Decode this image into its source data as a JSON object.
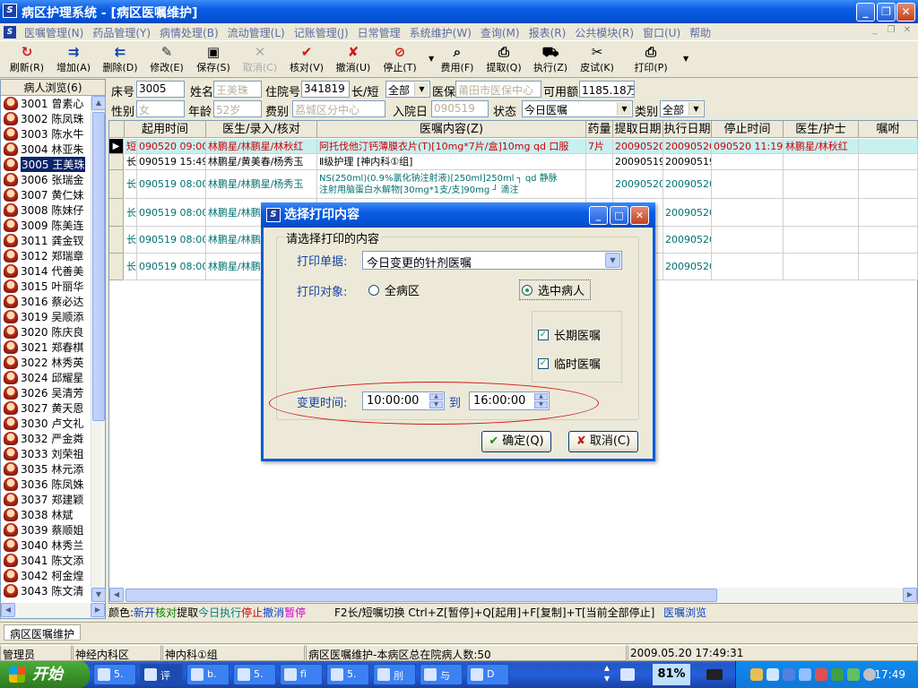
{
  "window": {
    "title": "病区护理系统 - [病区医嘱维护]",
    "app_icon": "S",
    "controls": [
      "_",
      "❐",
      "✕"
    ]
  },
  "menu": {
    "items": [
      "医嘱管理(N)",
      "药品管理(Y)",
      "病情处理(B)",
      "流动管理(L)",
      "记账管理(J)",
      "日常管理",
      "系统维护(W)",
      "查询(M)",
      "报表(R)",
      "公共模块(R)",
      "窗口(U)",
      "帮助"
    ],
    "mdi": [
      "_",
      "❐",
      "✕"
    ]
  },
  "toolbar": {
    "buttons": [
      {
        "label": "刷新(R)",
        "icon": "refresh-icon",
        "glyph": "↻",
        "color": "#d02020"
      },
      {
        "label": "增加(A)",
        "icon": "add-icon",
        "glyph": "⇉",
        "color": "#1040b0"
      },
      {
        "label": "删除(D)",
        "icon": "delete-icon",
        "glyph": "⇇",
        "color": "#1040b0"
      },
      {
        "label": "修改(E)",
        "icon": "edit-icon",
        "glyph": "✎",
        "color": "#303030"
      },
      {
        "label": "保存(S)",
        "icon": "save-icon",
        "glyph": "▣",
        "color": "#000"
      },
      {
        "label": "取消(C)",
        "icon": "cancel-icon",
        "glyph": "✕",
        "color": "#aaa"
      },
      {
        "label": "核对(V)",
        "icon": "check-icon",
        "glyph": "✔",
        "color": "#d01818"
      },
      {
        "label": "撤消(U)",
        "icon": "undo-icon",
        "glyph": "✘",
        "color": "#d01818"
      },
      {
        "label": "停止(T)",
        "icon": "stop-icon",
        "glyph": "⊘",
        "color": "#d01818"
      },
      {
        "label": "费用(F)",
        "icon": "fee-icon",
        "glyph": "⌕",
        "color": "#000"
      },
      {
        "label": "提取(Q)",
        "icon": "extract-icon",
        "glyph": "⎙",
        "color": "#000"
      },
      {
        "label": "执行(Z)",
        "icon": "execute-icon",
        "glyph": "⛟",
        "color": "#000"
      },
      {
        "label": "皮试(K)",
        "icon": "skintest-icon",
        "glyph": "✂",
        "color": "#000"
      },
      {
        "label": "打印(P)",
        "icon": "print-icon",
        "glyph": "⎙",
        "color": "#000"
      }
    ]
  },
  "left": {
    "header": "病人浏览(6)",
    "patients": [
      {
        "bed": "3001",
        "name": "曾素心"
      },
      {
        "bed": "3002",
        "name": "陈凤珠"
      },
      {
        "bed": "3003",
        "name": "陈水牛"
      },
      {
        "bed": "3004",
        "name": "林亚朱"
      },
      {
        "bed": "3005",
        "name": "王美珠"
      },
      {
        "bed": "3006",
        "name": "张瑞金"
      },
      {
        "bed": "3007",
        "name": "黄仁妹"
      },
      {
        "bed": "3008",
        "name": "陈妹仔"
      },
      {
        "bed": "3009",
        "name": "陈美连"
      },
      {
        "bed": "3011",
        "name": "龚金钗"
      },
      {
        "bed": "3012",
        "name": "郑瑞章"
      },
      {
        "bed": "3014",
        "name": "代善美"
      },
      {
        "bed": "3015",
        "name": "叶丽华"
      },
      {
        "bed": "3016",
        "name": "蔡必达"
      },
      {
        "bed": "3019",
        "name": "吴顺添"
      },
      {
        "bed": "3020",
        "name": "陈庆良"
      },
      {
        "bed": "3021",
        "name": "郑春棋"
      },
      {
        "bed": "3022",
        "name": "林秀英"
      },
      {
        "bed": "3024",
        "name": "邱耀星"
      },
      {
        "bed": "3026",
        "name": "吴清芳"
      },
      {
        "bed": "3027",
        "name": "黄天恩"
      },
      {
        "bed": "3030",
        "name": "卢文礼"
      },
      {
        "bed": "3032",
        "name": "严金粦"
      },
      {
        "bed": "3033",
        "name": "刘荣祖"
      },
      {
        "bed": "3035",
        "name": "林元添"
      },
      {
        "bed": "3036",
        "name": "陈凤姝"
      },
      {
        "bed": "3037",
        "name": "郑建颖"
      },
      {
        "bed": "3038",
        "name": "林斌"
      },
      {
        "bed": "3039",
        "name": "蔡顺姐"
      },
      {
        "bed": "3040",
        "name": "林秀兰"
      },
      {
        "bed": "3041",
        "name": "陈文添"
      },
      {
        "bed": "3042",
        "name": "柯金煌"
      },
      {
        "bed": "3043",
        "name": "陈文清"
      }
    ],
    "selected_index": 4
  },
  "form": {
    "bed_label": "床号",
    "bed": "3005",
    "name_label": "姓名",
    "name": "王美珠",
    "inpatient_label": "住院号",
    "inpatient_no": "341819",
    "term_label": "长/短",
    "term": "全部",
    "insurance_label": "医保",
    "insurance": "莆田市医保中心",
    "available_label": "可用额",
    "available": "1185.18万",
    "sex_label": "性别",
    "sex": "女",
    "age_label": "年龄",
    "age": "52岁",
    "fee_label": "费别",
    "fee": "荔城区分中心",
    "admit_label": "入院日",
    "admit": "090519",
    "status_label": "状态",
    "status": "今日医嘱",
    "category_label": "类别",
    "category": "全部"
  },
  "grid": {
    "columns": [
      "起用时间",
      "医生/录入/核对",
      "医嘱内容(Z)",
      "药量",
      "提取日期",
      "执行日期",
      "停止时间",
      "医生/护士",
      "嘱咐"
    ],
    "rows": [
      {
        "type": "短",
        "start": "090520 09:00",
        "doctor": "林鹏星/林鹏星/林秋红",
        "content": "阿托伐他汀钙薄膜衣片(T)[10mg*7片/盒]10mg qd 口服",
        "content2": "",
        "dose": "7片",
        "extract": "20090520",
        "execute": "20090520",
        "stop": "090520 11:19",
        "nurse": "林鹏星/林秋红",
        "note": "",
        "color": "red"
      },
      {
        "type": "长",
        "start": "090519 15:49",
        "doctor": "林鹏星/黄美春/杨秀玉",
        "content": "Ⅱ级护理   [神内科①组]",
        "content2": "",
        "dose": "",
        "extract": "20090519",
        "execute": "20090519",
        "stop": "",
        "nurse": "",
        "note": "",
        "color": "black"
      },
      {
        "type": "长",
        "start": "090519 08:00",
        "doctor": "林鹏星/林鹏星/杨秀玉",
        "content": "NS(250ml)(0.9%氯化钠注射液)[250ml]250ml ┐ qd 静脉",
        "content2": "注射用脑蛋白水解物[30mg*1支/支]90mg    ┘ 滴注",
        "dose": "",
        "extract": "20090520",
        "execute": "20090520",
        "stop": "",
        "nurse": "",
        "note": "",
        "color": "teal"
      },
      {
        "type": "长",
        "start": "090519 08:00",
        "doctor": "林鹏星/林鹏星/杨秀玉",
        "content": "",
        "content2": "",
        "dose": "",
        "extract": "",
        "execute": "20090520",
        "stop": "",
        "nurse": "",
        "note": "",
        "color": "teal"
      },
      {
        "type": "长",
        "start": "090519 08:00",
        "doctor": "林鹏星/林鹏星/杨秀玉",
        "content": "",
        "content2": "",
        "dose": "",
        "extract": "",
        "execute": "20090520",
        "stop": "",
        "nurse": "",
        "note": "",
        "color": "teal"
      },
      {
        "type": "长",
        "start": "090519 08:00",
        "doctor": "林鹏星/林鹏星/杨秀玉",
        "content": "",
        "content2": "",
        "dose": "",
        "extract": "",
        "execute": "20090520",
        "stop": "",
        "nurse": "",
        "note": "",
        "color": "teal"
      }
    ]
  },
  "legend": {
    "prefix": "颜色:",
    "items": [
      {
        "text": "新开",
        "color": "#1040c0"
      },
      {
        "text": "核对",
        "color": "#008000"
      },
      {
        "text": "提取",
        "color": "#000000"
      },
      {
        "text": "今日执行",
        "color": "#008080"
      },
      {
        "text": "停止",
        "color": "#d00000"
      },
      {
        "text": "撤消",
        "color": "#1040c0"
      },
      {
        "text": "暂停",
        "color": "#d000d0"
      }
    ],
    "shortcuts": "F2长/短嘱切换   Ctrl+Z[暂停]+Q[起用]+F[复制]+T[当前全部停止]",
    "browse": "医嘱浏览"
  },
  "doctab": {
    "label": "病区医嘱维护"
  },
  "status": {
    "user": "管理员",
    "dept": "神经内科区",
    "group": "神内科①组",
    "info": "病区医嘱维护-本病区总在院病人数:50",
    "datetime": "2009.05.20 17:49:31"
  },
  "taskbar": {
    "start": "开始",
    "tasks": [
      "5.",
      "评",
      "b.",
      "5.",
      "fì",
      "5.",
      "刖",
      "与",
      "D"
    ],
    "battery": "81%",
    "clock": "17:49"
  },
  "dialog": {
    "title": "选择打印内容",
    "group_label": "请选择打印的内容",
    "doc_label": "打印单据:",
    "doc_value": "今日变更的针剂医嘱",
    "target_label": "打印对象:",
    "radio_all": "全病区",
    "radio_selected": "选中病人",
    "selected_radio": "selected",
    "chk_long": "长期医嘱",
    "chk_long_checked": true,
    "chk_temp": "临时医嘱",
    "chk_temp_checked": true,
    "time_label": "变更时间:",
    "time_from": "10:00:00",
    "time_to_label": "到",
    "time_to": "16:00:00",
    "ok": "确定(Q)",
    "cancel": "取消(C)"
  }
}
